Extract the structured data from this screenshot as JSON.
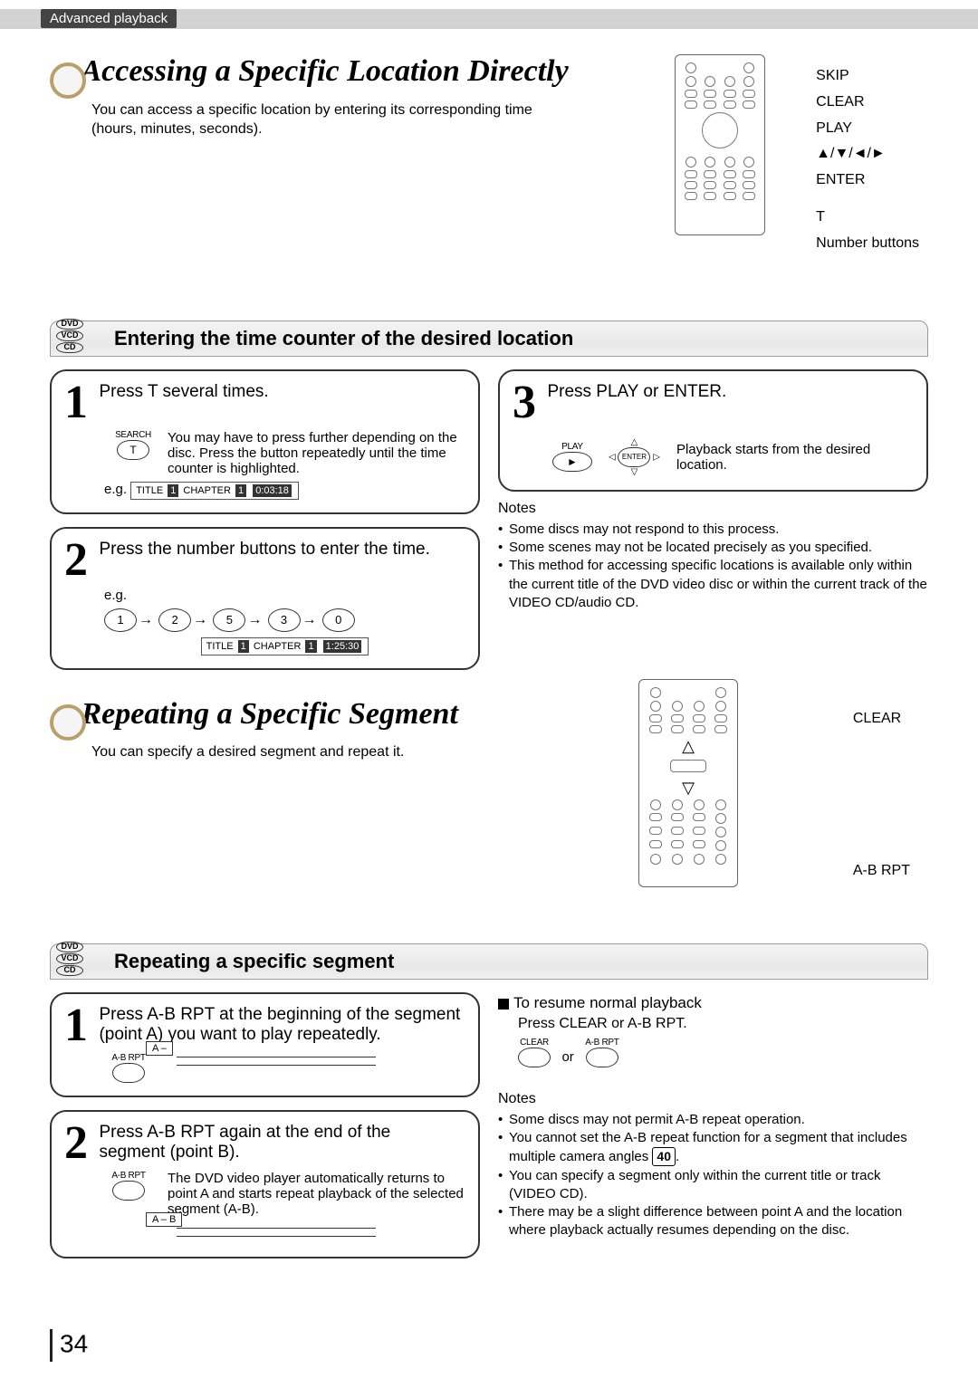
{
  "header_tab": "Advanced playback",
  "sectionA": {
    "title": "Accessing a Specific Location Directly",
    "desc": "You can access a specific location by entering its corresponding time (hours, minutes, seconds).",
    "remote_labels": [
      "SKIP",
      "CLEAR",
      "PLAY",
      "▲/▼/◄/►",
      "ENTER",
      "T",
      "Number buttons"
    ],
    "bar": "Entering the time counter of the desired location",
    "disc_tags": [
      "DVD",
      "VCD",
      "CD"
    ],
    "step1": {
      "head": "Press T several times.",
      "btn_label": "SEARCH",
      "btn_text": "T",
      "body": "You may have to press further depending on the disc. Press the button repeatedly until the time counter is highlighted.",
      "eg": "e.g.",
      "osd_title": "TITLE",
      "osd_tval": "1",
      "osd_chap": "CHAPTER",
      "osd_cval": "1",
      "osd_time": "0:03:18"
    },
    "step2": {
      "head": "Press the number buttons to enter the time.",
      "eg": "e.g.",
      "seq": [
        "1",
        "2",
        "5",
        "3",
        "0"
      ],
      "osd_title": "TITLE",
      "osd_tval": "1",
      "osd_chap": "CHAPTER",
      "osd_cval": "1",
      "osd_time": "1:25:30"
    },
    "step3": {
      "head": "Press PLAY or ENTER.",
      "play_label": "PLAY",
      "play_glyph": "►",
      "enter_label": "ENTER",
      "result": "Playback starts from the desired location."
    },
    "notes_head": "Notes",
    "notes": [
      "Some discs may not respond to this process.",
      "Some scenes may not be located precisely as you specified.",
      "This method for accessing specific locations is available only within the current title of the DVD video disc or within the current track of the VIDEO CD/audio CD."
    ]
  },
  "sectionB": {
    "title": "Repeating a Specific Segment",
    "desc": "You can specify a desired segment and repeat it.",
    "remote_labels": [
      "CLEAR",
      "A-B RPT"
    ],
    "bar": "Repeating a specific segment",
    "disc_tags": [
      "DVD",
      "VCD",
      "CD"
    ],
    "step1": {
      "head": "Press A-B RPT at the beginning of the segment (point A) you want to play repeatedly.",
      "btn_label": "A-B RPT",
      "tag": "A –"
    },
    "step2": {
      "head": "Press A-B RPT again at the end of the segment (point B).",
      "btn_label": "A-B RPT",
      "body": "The DVD video player automatically returns to point A and starts repeat playback of the selected segment (A-B).",
      "tag": "A – B"
    },
    "resume_head": "To resume normal playback",
    "resume_body": "Press CLEAR or A-B RPT.",
    "clear_label": "CLEAR",
    "abrpt_label": "A-B RPT",
    "or": "or",
    "notes_head": "Notes",
    "ref": "40",
    "notes": [
      "Some discs may not permit A-B repeat operation.",
      "You cannot set the A-B repeat function for a segment that includes multiple camera angles",
      "You can specify a segment only within the current title or track (VIDEO CD).",
      "There may be a slight difference between point A and the location where playback actually resumes depending on the disc."
    ]
  },
  "page_number": "34"
}
